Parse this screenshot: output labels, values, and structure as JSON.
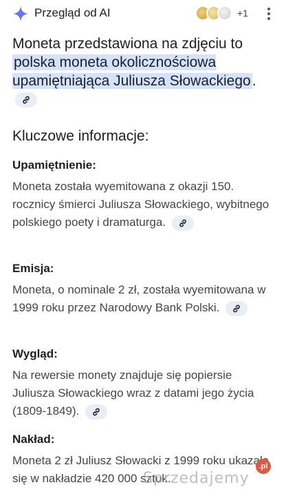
{
  "header": {
    "title": "Przegląd od AI",
    "sources_more": "+1"
  },
  "intro": {
    "prefix": "Moneta przedstawiona na zdjęciu to ",
    "highlight": "polska moneta okolicznościowa upamiętniająca Juliusza Słowackiego",
    "suffix": "."
  },
  "section_title": "Kluczowe informacje:",
  "items": [
    {
      "heading": "Upamiętnienie:",
      "text": "Moneta została wyemitowana z okazji 150. rocznicy śmierci Juliusza Słowackiego, wybitnego polskiego poety i dramaturga."
    },
    {
      "heading": "Emisja:",
      "text": "Moneta, o nominale 2 zł, została wyemitowana w 1999 roku przez Narodowy Bank Polski."
    },
    {
      "heading": "Wygląd:",
      "text": "Na rewersie monety znajduje się popiersie Juliusza Słowackiego wraz z datami jego życia (1809-1849)."
    },
    {
      "heading": "Nakład:",
      "text": "Moneta 2 zł Juliusz Słowacki z 1999 roku ukazała się w nakładzie 420 000 sztuk."
    }
  ],
  "watermark": {
    "text": "Sprzedajemy",
    "badge": ".pl"
  }
}
